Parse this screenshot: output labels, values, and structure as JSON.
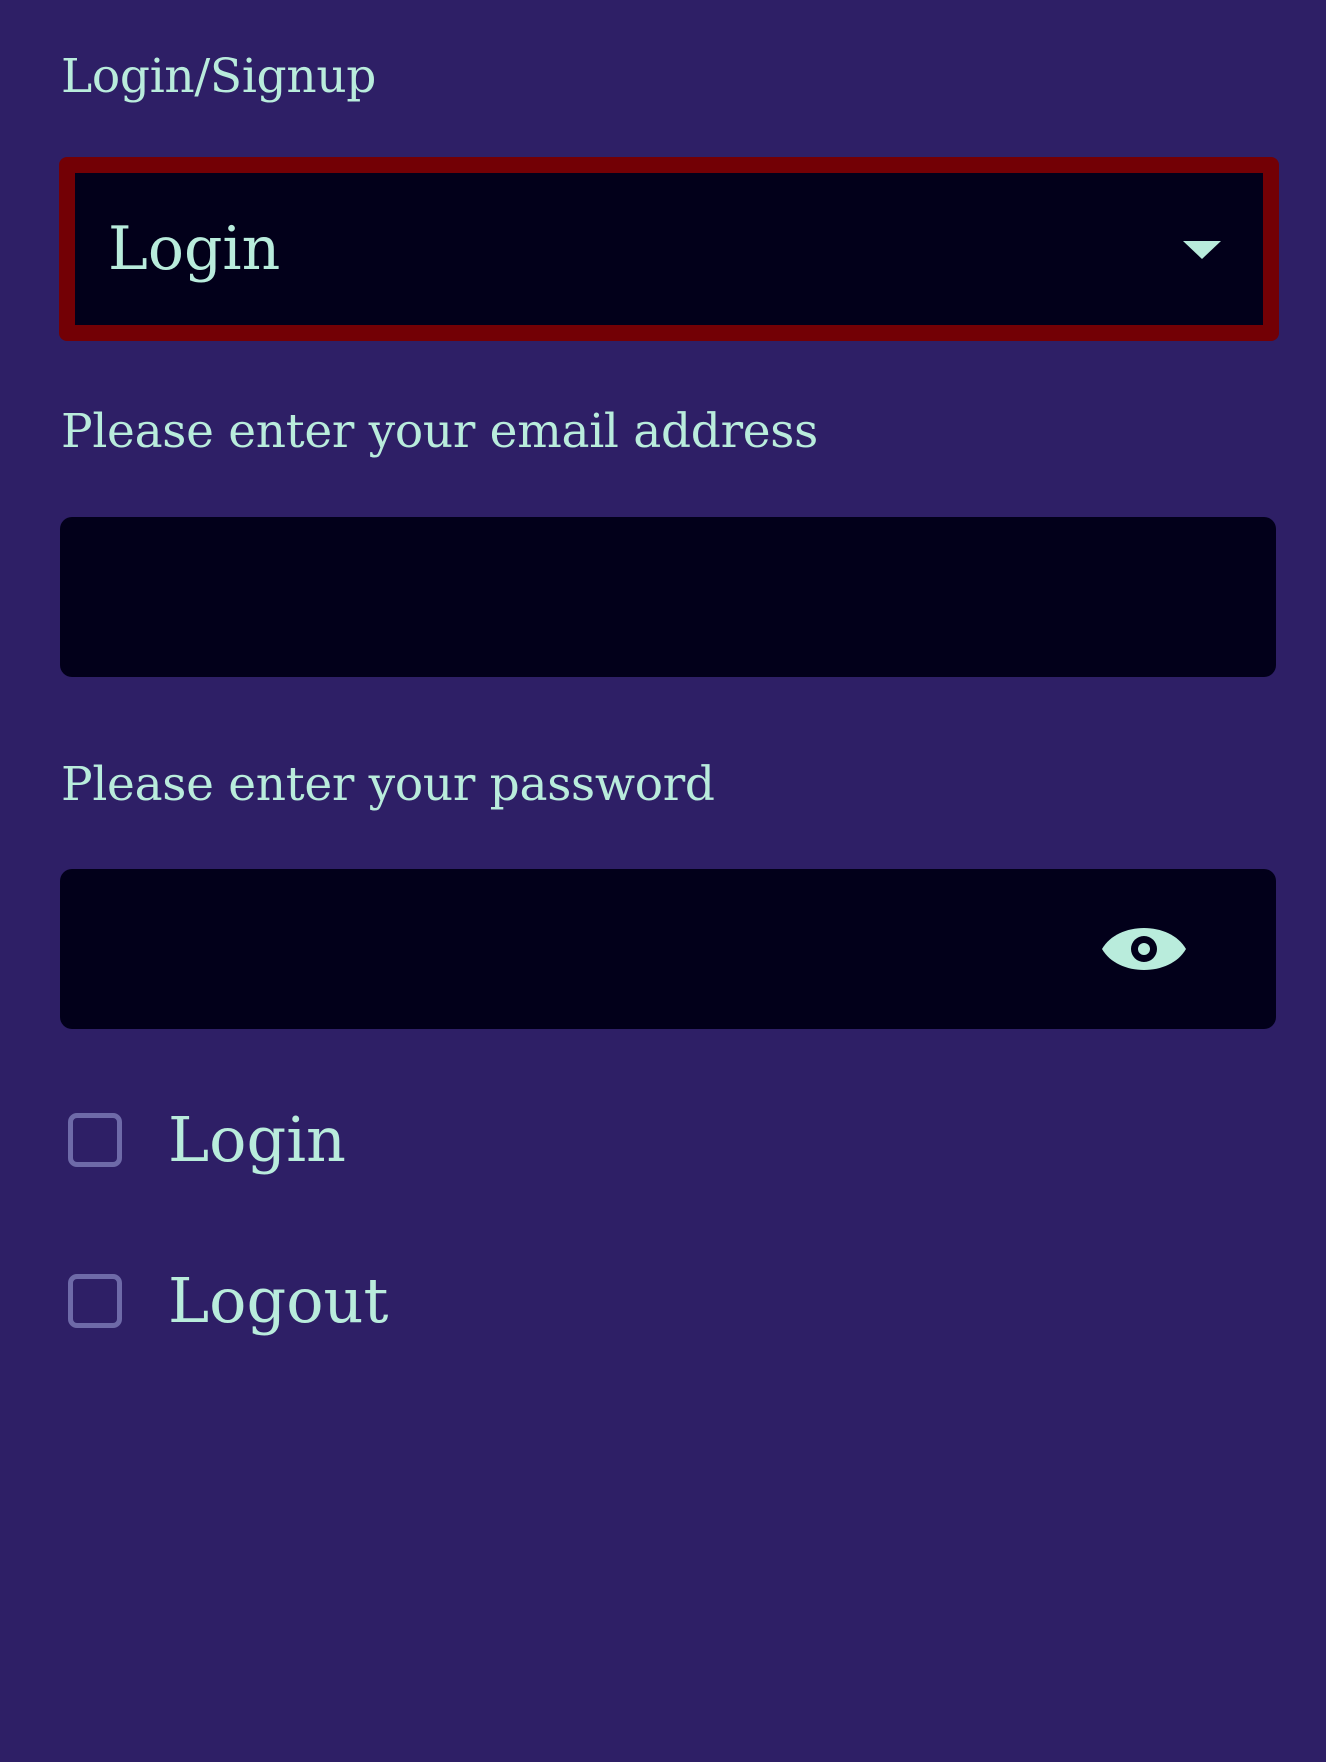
{
  "colors": {
    "background": "#2e1f66",
    "field_background": "#02001a",
    "text": "#b9ecdc",
    "focus_border": "#730005",
    "checkbox_border": "#6e6aa8"
  },
  "mode_field": {
    "label": "Login/Signup",
    "selected_value": "Login",
    "caret_icon": "caret-down-icon"
  },
  "email_field": {
    "label": "Please enter your email address",
    "value": ""
  },
  "password_field": {
    "label": "Please enter your password",
    "value": "",
    "toggle_icon": "eye-icon"
  },
  "checkboxes": [
    {
      "label": "Login",
      "checked": false
    },
    {
      "label": "Logout",
      "checked": false
    }
  ]
}
